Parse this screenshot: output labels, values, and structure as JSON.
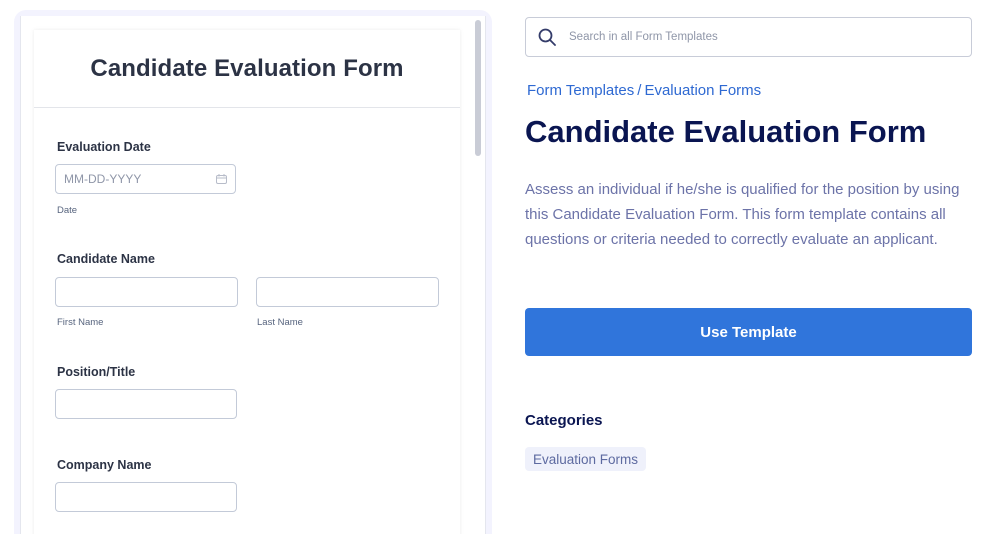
{
  "preview": {
    "form_title": "Candidate Evaluation Form",
    "fields": {
      "evaluation_date": {
        "label": "Evaluation Date",
        "placeholder": "MM-DD-YYYY",
        "icon": "calendar-icon",
        "sublabel": "Date"
      },
      "candidate_name": {
        "label": "Candidate Name",
        "first_sublabel": "First Name",
        "last_sublabel": "Last Name"
      },
      "position_title": {
        "label": "Position/Title"
      },
      "company_name": {
        "label": "Company Name"
      }
    }
  },
  "search": {
    "placeholder": "Search in all Form Templates",
    "icon": "search-icon"
  },
  "breadcrumb": {
    "root": "Form Templates",
    "separator": "/",
    "current": "Evaluation Forms"
  },
  "template": {
    "title": "Candidate Evaluation Form",
    "description": "Assess an individual if he/she is qualified for the position by using this Candidate Evaluation Form. This form template contains all questions or criteria needed to correctly evaluate an applicant.",
    "use_button_label": "Use Template"
  },
  "categories": {
    "heading": "Categories",
    "items": [
      "Evaluation Forms"
    ]
  },
  "colors": {
    "accent": "#3075db",
    "link": "#2e69d2",
    "title": "#0a1551",
    "body_text": "#6c73a8",
    "tag_bg": "#eff1fb"
  }
}
